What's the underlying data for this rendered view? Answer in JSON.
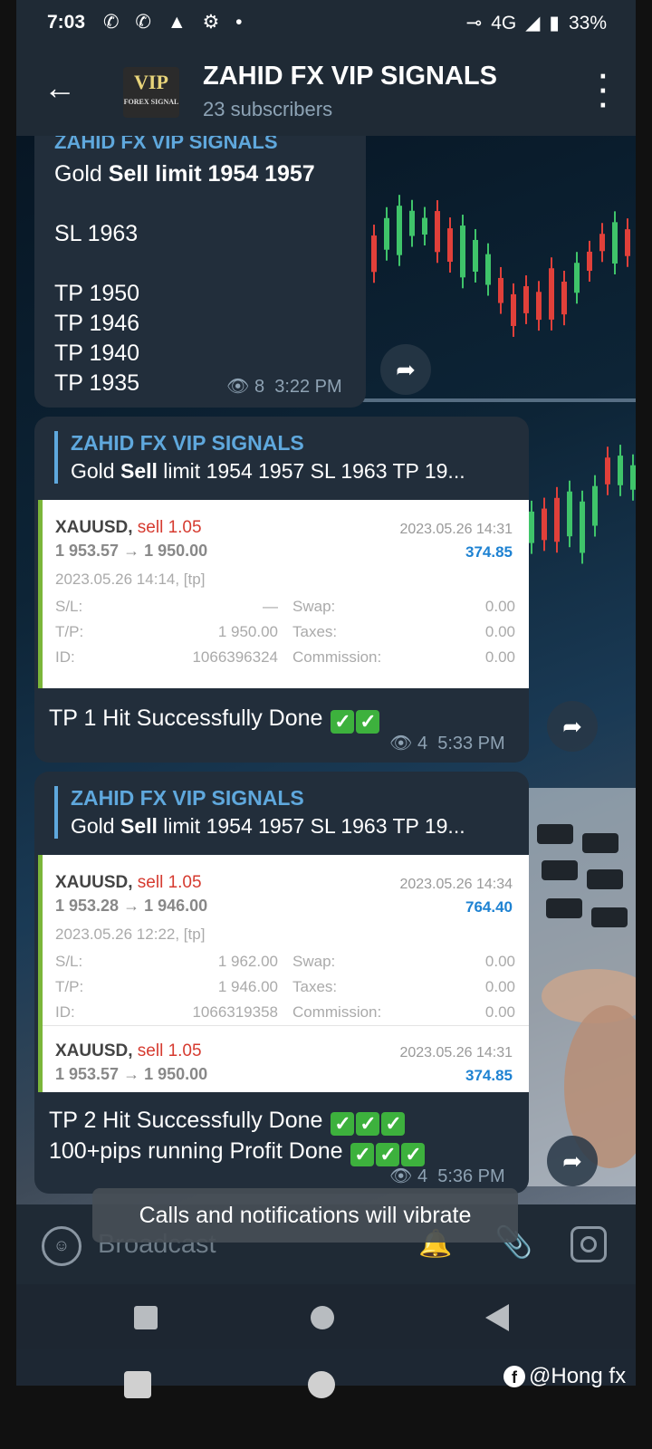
{
  "status_bar": {
    "time": "7:03",
    "left_icons": "✆ ✆ ▲ ⚙ •",
    "network": "4G",
    "battery": "33%"
  },
  "header": {
    "title": "ZAHID FX VIP SIGNALS",
    "subtitle": "23 subscribers",
    "avatar_text": "VIP",
    "avatar_sub": "FOREX SIGNAL"
  },
  "messages": [
    {
      "cut_title": "ZAHID FX VIP SIGNALS",
      "lines": [
        "Gold Sell  limit 1954 1957",
        "",
        "SL 1963",
        "",
        "TP 1950",
        "TP 1946",
        "TP 1940",
        "TP 1935"
      ],
      "line_prefix": "Gold ",
      "line_bold": "Sell  limit 1954 1957",
      "views": "8",
      "time": "3:22 PM"
    },
    {
      "reply_title": "ZAHID FX VIP SIGNALS",
      "reply_text_prefix": "Gold ",
      "reply_text_bold": "Sell",
      "reply_text_rest": "  limit 1954 1957  SL 1963  TP 19...",
      "trade": {
        "symbol": "XAUUSD,",
        "side": "sell 1.05",
        "prices": "1 953.57 → 1 950.00",
        "close_time": "2023.05.26 14:31",
        "profit": "374.85",
        "open_time": "2023.05.26 14:14, [tp]",
        "sl_label": "S/L:",
        "sl": "—",
        "swap_label": "Swap:",
        "swap": "0.00",
        "tp_label": "T/P:",
        "tp": "1 950.00",
        "taxes_label": "Taxes:",
        "taxes": "0.00",
        "id_label": "ID:",
        "id": "1066396324",
        "commission_label": "Commission:",
        "commission": "0.00"
      },
      "text": "TP 1 Hit Successfully Done",
      "checks": "✓✓",
      "views": "4",
      "time": "5:33 PM"
    },
    {
      "reply_title": "ZAHID FX VIP SIGNALS",
      "reply_text_prefix": "Gold ",
      "reply_text_bold": "Sell",
      "reply_text_rest": "  limit 1954 1957  SL 1963  TP 19...",
      "trade": {
        "symbol": "XAUUSD,",
        "side": "sell 1.05",
        "prices": "1 953.28 → 1 946.00",
        "close_time": "2023.05.26 14:34",
        "profit": "764.40",
        "open_time": "2023.05.26 12:22, [tp]",
        "sl_label": "S/L:",
        "sl": "1 962.00",
        "swap_label": "Swap:",
        "swap": "0.00",
        "tp_label": "T/P:",
        "tp": "1 946.00",
        "taxes_label": "Taxes:",
        "taxes": "0.00",
        "id_label": "ID:",
        "id": "1066319358",
        "commission_label": "Commission:",
        "commission": "0.00"
      },
      "trade2": {
        "symbol": "XAUUSD,",
        "side": "sell 1.05",
        "prices": "1 953.57 → 1 950.00",
        "close_time": "2023.05.26 14:31",
        "profit": "374.85"
      },
      "text1": "TP 2 Hit Successfully Done",
      "text2": "100+pips running Profit Done",
      "checks": "✓✓✓",
      "views": "4",
      "time": "5:36 PM"
    }
  ],
  "toast": "Calls and notifications will vibrate",
  "composer": {
    "placeholder": "Broadcast"
  },
  "watermark": "@Hong fx"
}
